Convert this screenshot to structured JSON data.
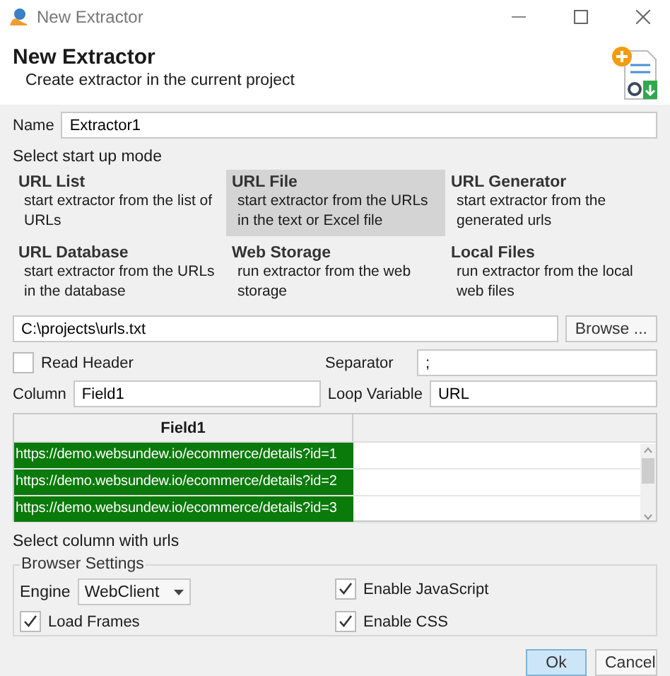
{
  "window": {
    "title": "New Extractor"
  },
  "header": {
    "title": "New Extractor",
    "subtitle": "Create extractor in the current project"
  },
  "name_field": {
    "label": "Name",
    "value": "Extractor1"
  },
  "mode_section": {
    "label": "Select start up mode"
  },
  "modes": [
    {
      "title": "URL List",
      "description": "start extractor from the list of URLs",
      "selected": false
    },
    {
      "title": "URL File",
      "description": "start extractor from the URLs in the text or Excel file",
      "selected": true
    },
    {
      "title": "URL Generator",
      "description": "start extractor from the generated urls",
      "selected": false
    },
    {
      "title": "URL Database",
      "description": "start extractor from the URLs in the database",
      "selected": false
    },
    {
      "title": "Web Storage",
      "description": "run extractor from the web storage",
      "selected": false
    },
    {
      "title": "Local Files",
      "description": "run extractor from the local web files",
      "selected": false
    }
  ],
  "file_path": {
    "value": "C:\\projects\\urls.txt",
    "button": "Browse ..."
  },
  "read_header": {
    "label": "Read Header",
    "checked": false
  },
  "separator": {
    "label": "Separator",
    "value": ";"
  },
  "column": {
    "label": "Column",
    "value": "Field1"
  },
  "loop_variable": {
    "label": "Loop Variable",
    "value": "URL"
  },
  "table": {
    "columns": [
      "Field1"
    ],
    "rows": [
      {
        "cells": [
          "https://demo.websundew.io/ecommerce/details?id=1"
        ],
        "selected": true
      },
      {
        "cells": [
          "https://demo.websundew.io/ecommerce/details?id=2"
        ],
        "selected": true
      },
      {
        "cells": [
          "https://demo.websundew.io/ecommerce/details?id=3"
        ],
        "selected": true
      }
    ]
  },
  "table_hint": "Select column with urls",
  "browser_settings": {
    "title": "Browser Settings",
    "engine_label": "Engine",
    "engine": "WebClient",
    "options": [
      {
        "label": "Enable JavaScript",
        "checked": true
      },
      {
        "label": "Load Frames",
        "checked": true
      },
      {
        "label": "Enable CSS",
        "checked": true
      }
    ]
  },
  "buttons": [
    {
      "label": "Ok",
      "primary": true
    },
    {
      "label": "Cancel",
      "primary": false
    }
  ]
}
